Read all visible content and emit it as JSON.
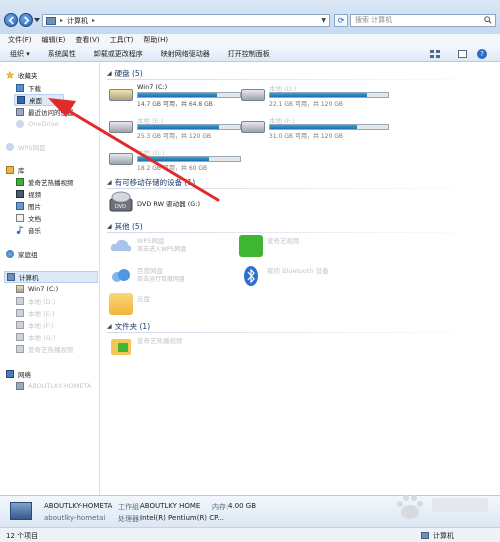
{
  "address": {
    "crumb": "计算机",
    "search_placeholder": "搜索 计算机"
  },
  "menu": [
    "文件(F)",
    "编辑(E)",
    "查看(V)",
    "工具(T)",
    "帮助(H)"
  ],
  "commands": [
    "组织 ▾",
    "系统属性",
    "卸载或更改程序",
    "映射网络驱动器",
    "打开控制面板"
  ],
  "sidebar": {
    "favorites": "收藏夹",
    "download": "下载",
    "desktop": "桌面",
    "recent": "最近访问的位置",
    "onedrive": "OneDrive",
    "wps": "WPS网盘",
    "library": "库",
    "lib_video_app": "爱奇艺热播视频",
    "video": "视频",
    "pictures": "图片",
    "docs": "文档",
    "music": "音乐",
    "homegroup": "家庭组",
    "computer": "计算机",
    "win7c": "Win7 (C:)",
    "drive2": "本地 (D:)",
    "drive3": "本地 (E:)",
    "drive4": "本地 (F:)",
    "drive5": "本地 (G:)",
    "drive6": "爱奇艺热播视频",
    "network": "网络",
    "host": "ABOUTLKY-HOMETA"
  },
  "groups": {
    "hdd": "硬盘 (5)",
    "removable": "有可移动存储的设备 (1)",
    "other": "其他 (5)",
    "folders": "文件夹 (1)"
  },
  "drives": [
    {
      "name": "Win7 (C:)",
      "free": "14.7 GB 可用，共 64.8 GB",
      "used_pct": 77
    },
    {
      "name": "本地 (D:)",
      "free": "22.1 GB 可用，共 120 GB",
      "used_pct": 82
    },
    {
      "name": "本地 (E:)",
      "free": "25.3 GB 可用，共 120 GB",
      "used_pct": 79
    },
    {
      "name": "本地 (F:)",
      "free": "31.0 GB 可用，共 120 GB",
      "used_pct": 74
    },
    {
      "name": "本地 (G:)",
      "free": "18.2 GB 可用，共 60 GB",
      "used_pct": 70
    }
  ],
  "removable": [
    {
      "name": "DVD RW 驱动器 (G:)"
    }
  ],
  "others": [
    {
      "name": "WPS网盘",
      "sub": "双击进入WPS网盘"
    },
    {
      "name": "爱奇艺视频",
      "sub": ""
    },
    {
      "name": "百度网盘",
      "sub": "双击运行百度网盘"
    },
    {
      "name": "我的 Bluetooth 设备",
      "sub": ""
    },
    {
      "name": "云盘",
      "sub": ""
    }
  ],
  "folders": [
    {
      "name": "爱奇艺热播视频",
      "sub": ""
    }
  ],
  "details": {
    "pc_name": "ABOUTLKY-HOMETA",
    "workgroup_label": "工作组:",
    "workgroup": "ABOUTLKY HOME",
    "memory_label": "内存:",
    "memory": "4.00 GB",
    "user": "aboutlky-hometai",
    "cpu_label": "处理器:",
    "cpu": "Intel(R) Pentium(R) CP..."
  },
  "status": {
    "count": "12 个项目",
    "right": "计算机"
  },
  "colors": {
    "accent": "#2a62b8",
    "arrow": "#e02b2b",
    "bar": "#1a6fb0"
  }
}
